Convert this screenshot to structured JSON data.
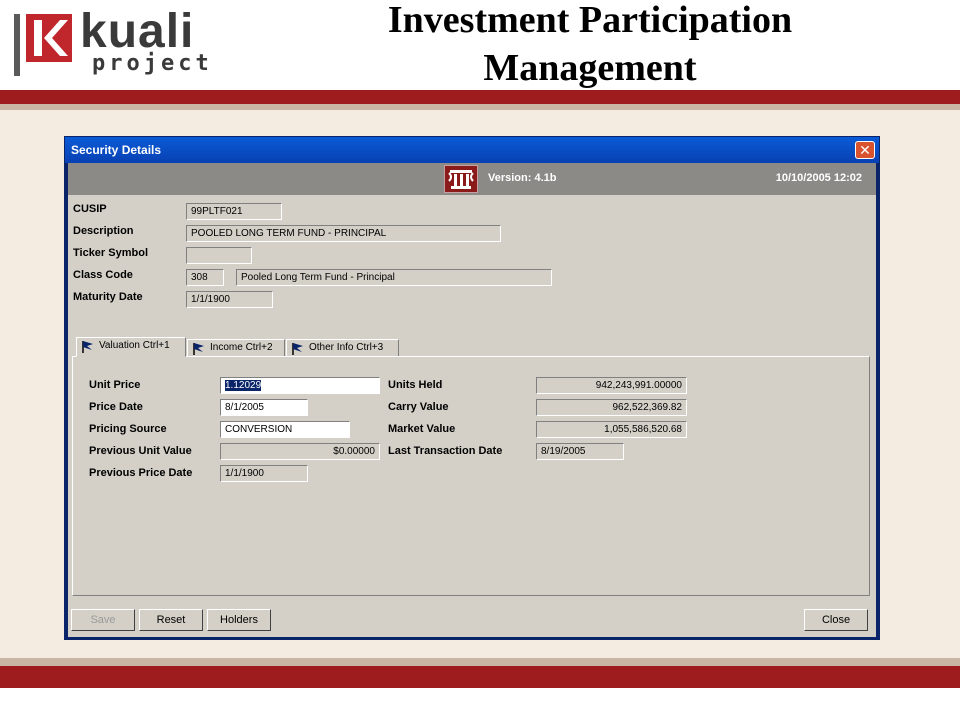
{
  "slide": {
    "logo_word": "kuali",
    "logo_sub": "project",
    "title_line1": "Investment Participation",
    "title_line2": "Management"
  },
  "window": {
    "title": "Security Details",
    "close_glyph": "✕",
    "version": "Version: 4.1b",
    "datetime": "10/10/2005 12:02"
  },
  "header_fields": {
    "cusip": {
      "label": "CUSIP",
      "value": "99PLTF021"
    },
    "description": {
      "label": "Description",
      "value": "POOLED LONG TERM FUND - PRINCIPAL"
    },
    "ticker": {
      "label": "Ticker Symbol",
      "value": ""
    },
    "class_code": {
      "label": "Class Code",
      "code": "308",
      "name": "Pooled Long Term Fund - Principal"
    },
    "maturity": {
      "label": "Maturity Date",
      "value": "1/1/1900"
    }
  },
  "tabs": [
    {
      "label": "Valuation Ctrl+1",
      "active": true
    },
    {
      "label": "Income Ctrl+2",
      "active": false
    },
    {
      "label": "Other Info Ctrl+3",
      "active": false
    }
  ],
  "valuation": {
    "unit_price": {
      "label": "Unit Price",
      "value": "1.12029"
    },
    "price_date": {
      "label": "Price Date",
      "value": "8/1/2005"
    },
    "pricing_source": {
      "label": "Pricing Source",
      "value": "CONVERSION"
    },
    "prev_unit_value": {
      "label": "Previous Unit Value",
      "value": "$0.00000"
    },
    "prev_price_date": {
      "label": "Previous Price Date",
      "value": "1/1/1900"
    },
    "units_held": {
      "label": "Units Held",
      "value": "942,243,991.00000"
    },
    "carry_value": {
      "label": "Carry Value",
      "value": "962,522,369.82"
    },
    "market_value": {
      "label": "Market Value",
      "value": "1,055,586,520.68"
    },
    "last_txn_date": {
      "label": "Last Transaction Date",
      "value": "8/19/2005"
    }
  },
  "buttons": {
    "save": "Save",
    "reset": "Reset",
    "holders": "Holders",
    "close": "Close"
  },
  "colors": {
    "band_red": "#9e1b1e",
    "titlebar_blue": "#0a5bd6",
    "window_face": "#d4d0c8"
  }
}
